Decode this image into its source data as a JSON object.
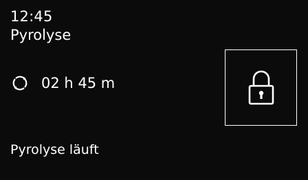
{
  "header": {
    "time": "12:45",
    "program": "Pyrolyse"
  },
  "duration": {
    "icon": "cycle-icon",
    "value": "02 h 45 m"
  },
  "lock": {
    "icon": "padlock-icon"
  },
  "status": {
    "text": "Pyrolyse läuft"
  },
  "colors": {
    "background": "#0b0b0b",
    "foreground": "#ffffff"
  }
}
